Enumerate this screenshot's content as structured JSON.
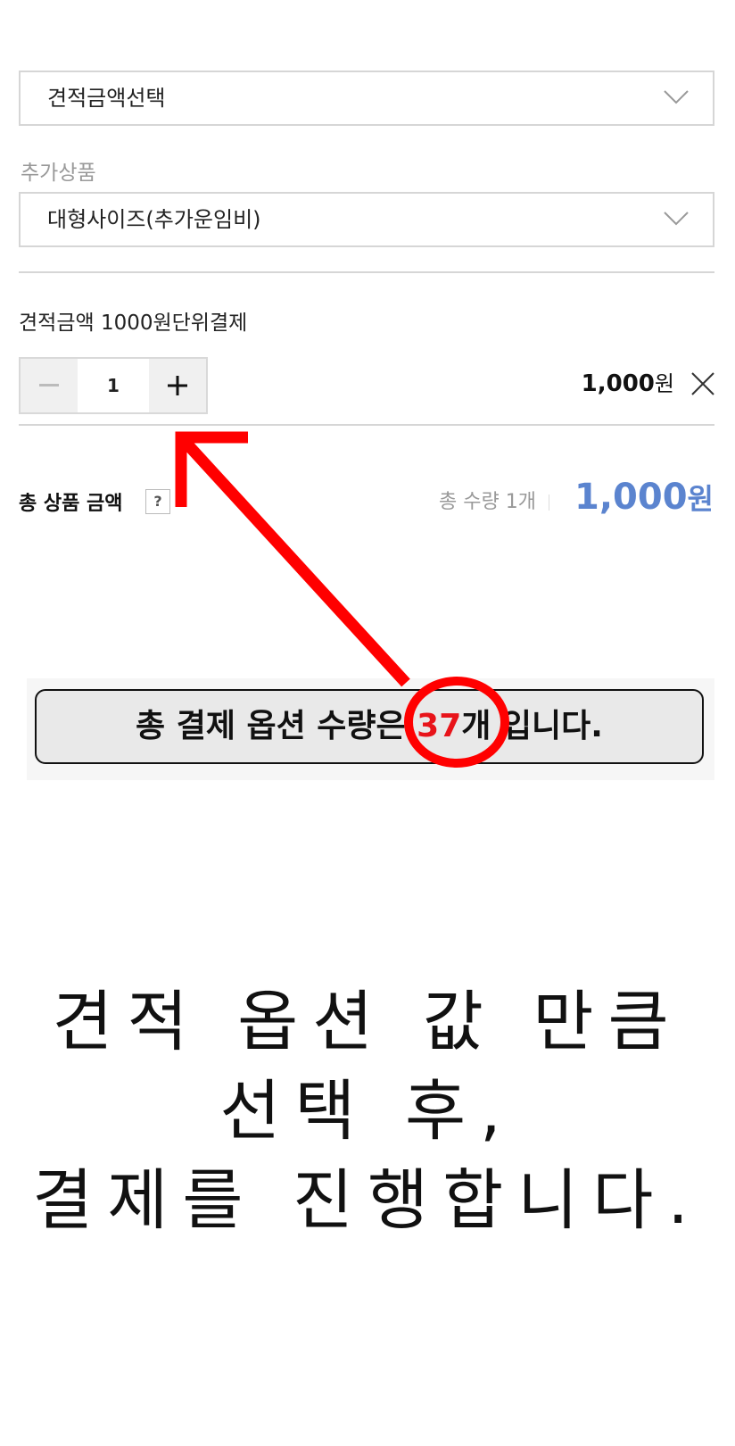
{
  "select_estimate": {
    "value": "견적금액선택",
    "icon": "chevron-down-icon"
  },
  "addon": {
    "label": "추가상품",
    "value": "대형사이즈(추가운임비)",
    "icon": "chevron-down-icon"
  },
  "option": {
    "title": "견적금액 1000원단위결제",
    "quantity": "1",
    "minus_symbol": "−",
    "plus_symbol": "+",
    "price_number": "1,000",
    "price_unit": "원",
    "remove_icon": "close-icon"
  },
  "total": {
    "label": "총 상품 금액",
    "help": "?",
    "qty_text": "총 수량 1개",
    "price_number": "1,000",
    "price_unit": "원",
    "price_color": "#5b84cf"
  },
  "notice": {
    "prefix": "총 결제 옵션 수량은 ",
    "count": "37",
    "suffix": "개 입니다.",
    "highlight_color": "#e8141a"
  },
  "instructions": {
    "line1": "견적 옵션 값 만큼",
    "line2": "선택 후,",
    "line3": "결제를 진행합니다."
  },
  "annotation_color": "#ff0000"
}
